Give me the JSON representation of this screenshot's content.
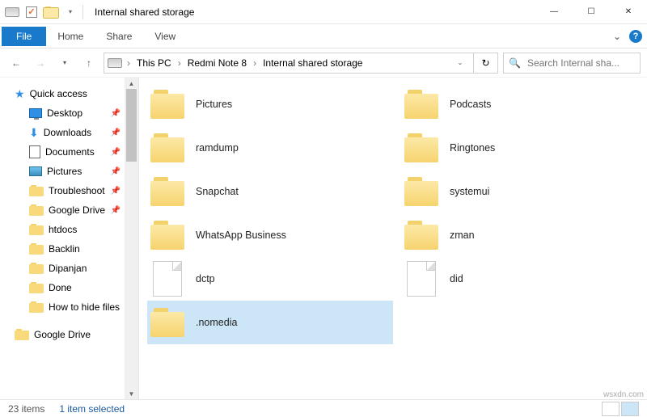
{
  "window": {
    "title": "Internal shared storage"
  },
  "ribbon": {
    "file": "File",
    "tabs": [
      "Home",
      "Share",
      "View"
    ]
  },
  "address": {
    "crumbs": [
      "This PC",
      "Redmi Note 8",
      "Internal shared storage"
    ]
  },
  "search": {
    "placeholder": "Search Internal sha..."
  },
  "nav": {
    "quick_access": "Quick access",
    "items": [
      {
        "label": "Desktop",
        "pinned": true,
        "icon": "desktop"
      },
      {
        "label": "Downloads",
        "pinned": true,
        "icon": "down"
      },
      {
        "label": "Documents",
        "pinned": true,
        "icon": "doc"
      },
      {
        "label": "Pictures",
        "pinned": true,
        "icon": "pic"
      },
      {
        "label": "Troubleshoot",
        "pinned": true,
        "icon": "folder"
      },
      {
        "label": "Google Drive",
        "pinned": true,
        "icon": "folder"
      },
      {
        "label": "htdocs",
        "pinned": false,
        "icon": "folder"
      },
      {
        "label": "Backlin",
        "pinned": false,
        "icon": "folder"
      },
      {
        "label": "Dipanjan",
        "pinned": false,
        "icon": "folder"
      },
      {
        "label": "Done",
        "pinned": false,
        "icon": "folder"
      },
      {
        "label": "How to hide files",
        "pinned": false,
        "icon": "folder"
      }
    ],
    "second_group": "Google Drive"
  },
  "files": {
    "col1": [
      {
        "name": "Pictures",
        "type": "folder"
      },
      {
        "name": "ramdump",
        "type": "folder"
      },
      {
        "name": "Snapchat",
        "type": "folder"
      },
      {
        "name": "WhatsApp Business",
        "type": "folder"
      },
      {
        "name": "dctp",
        "type": "file"
      },
      {
        "name": ".nomedia",
        "type": "folder",
        "selected": true
      }
    ],
    "col2": [
      {
        "name": "Podcasts",
        "type": "folder"
      },
      {
        "name": "Ringtones",
        "type": "folder"
      },
      {
        "name": "systemui",
        "type": "folder"
      },
      {
        "name": "zman",
        "type": "folder"
      },
      {
        "name": "did",
        "type": "file"
      }
    ]
  },
  "status": {
    "count": "23 items",
    "selected": "1 item selected"
  },
  "watermark": "wsxdn.com"
}
